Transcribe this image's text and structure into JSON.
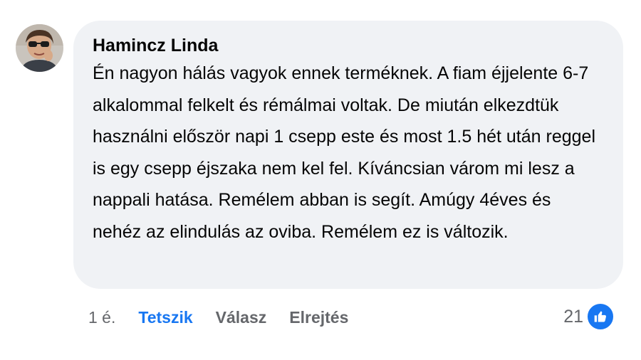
{
  "comment": {
    "author": "Hamincz Linda",
    "text": "Én nagyon hálás vagyok ennek terméknek. A fiam éjjelente 6-7 alkalommal felkelt és rémálmai voltak. De miután elkezdtük használni először napi 1 csepp este és most 1.5 hét után reggel is egy csepp éjszaka nem kel fel. Kíváncsian várom mi lesz a nappali hatása. Remélem abban is segít. Amúgy 4éves és nehéz az elindulás az oviba. Remélem ez is változik.",
    "time": "1 é.",
    "like_label": "Tetszik",
    "reply_label": "Válasz",
    "hide_label": "Elrejtés",
    "reaction_count": "21",
    "reaction_icon": "thumbs-up-icon"
  },
  "colors": {
    "accent": "#1877f2",
    "bubble_bg": "#f0f2f5",
    "muted_text": "#65676b"
  }
}
